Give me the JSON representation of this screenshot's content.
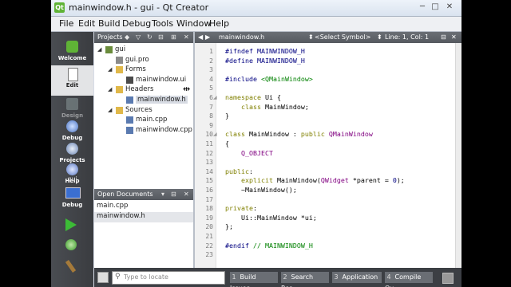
{
  "window": {
    "title": "mainwindow.h - gui - Qt Creator",
    "app_icon": "Qt",
    "controls": {
      "minimize": "─",
      "maximize": "□",
      "close": "✕"
    }
  },
  "menubar": [
    "File",
    "Edit",
    "Build",
    "Debug",
    "Tools",
    "Window",
    "Help"
  ],
  "modes": [
    {
      "label": "Welcome",
      "icon": "qt-logo-icon"
    },
    {
      "label": "Edit",
      "icon": "edit-document-icon",
      "selected": true
    },
    {
      "label": "Design",
      "icon": "design-icon"
    },
    {
      "label": "Debug",
      "icon": "debug-icon"
    },
    {
      "label": "Projects",
      "icon": "projects-icon"
    },
    {
      "label": "Help",
      "icon": "help-icon"
    }
  ],
  "kit": {
    "project": "gui",
    "config": "Debug"
  },
  "projects_pane": {
    "title": "Projects",
    "tree": [
      {
        "label": "gui",
        "level": 0,
        "expanded": true,
        "kind": "project"
      },
      {
        "label": "gui.pro",
        "level": 1,
        "kind": "pro"
      },
      {
        "label": "Forms",
        "level": 1,
        "expanded": true,
        "kind": "folder"
      },
      {
        "label": "mainwindow.ui",
        "level": 2,
        "kind": "ui"
      },
      {
        "label": "Headers",
        "level": 1,
        "expanded": true,
        "kind": "folder"
      },
      {
        "label": "mainwindow.h",
        "level": 2,
        "kind": "h",
        "selected": true
      },
      {
        "label": "Sources",
        "level": 1,
        "expanded": true,
        "kind": "folder"
      },
      {
        "label": "main.cpp",
        "level": 2,
        "kind": "cpp"
      },
      {
        "label": "mainwindow.cpp",
        "level": 2,
        "kind": "cpp"
      }
    ]
  },
  "open_documents": {
    "title": "Open Documents",
    "items": [
      {
        "label": "main.cpp"
      },
      {
        "label": "mainwindow.h",
        "selected": true
      }
    ]
  },
  "editor": {
    "file": "mainwindow.h",
    "symbol": "<Select Symbol>",
    "position": "Line: 1, Col: 1",
    "lines": [
      {
        "n": "1",
        "t": [
          [
            "#ifndef MAINWINDOW_H",
            "pp"
          ]
        ]
      },
      {
        "n": "2",
        "t": [
          [
            "#define MAINWINDOW_H",
            "pp"
          ]
        ]
      },
      {
        "n": "3",
        "t": []
      },
      {
        "n": "4",
        "t": [
          [
            "#include ",
            "pp"
          ],
          [
            "<QMainWindow>",
            "str"
          ]
        ]
      },
      {
        "n": "5",
        "t": []
      },
      {
        "n": "6",
        "t": [
          [
            "namespace ",
            "kw"
          ],
          [
            "Ui {",
            "id"
          ]
        ],
        "fold": true
      },
      {
        "n": "7",
        "t": [
          [
            "    class ",
            "kw"
          ],
          [
            "MainWindow;",
            "id"
          ]
        ]
      },
      {
        "n": "8",
        "t": [
          [
            "}",
            "id"
          ]
        ]
      },
      {
        "n": "9",
        "t": []
      },
      {
        "n": "10",
        "t": [
          [
            "class ",
            "kw"
          ],
          [
            "MainWindow : ",
            "id"
          ],
          [
            "public ",
            "kw"
          ],
          [
            "QMainWindow",
            "ty"
          ]
        ],
        "fold": true
      },
      {
        "n": "11",
        "t": [
          [
            "{",
            "id"
          ]
        ]
      },
      {
        "n": "12",
        "t": [
          [
            "    Q_OBJECT",
            "ty"
          ]
        ]
      },
      {
        "n": "13",
        "t": []
      },
      {
        "n": "14",
        "t": [
          [
            "public",
            "kw"
          ],
          [
            ":",
            "id"
          ]
        ]
      },
      {
        "n": "15",
        "t": [
          [
            "    explicit ",
            "kw"
          ],
          [
            "MainWindow(",
            "id"
          ],
          [
            "QWidget",
            "ty"
          ],
          [
            " *parent = ",
            "id"
          ],
          [
            "0",
            "num"
          ],
          [
            ");",
            "id"
          ]
        ]
      },
      {
        "n": "16",
        "t": [
          [
            "    ~MainWindow();",
            "id"
          ]
        ]
      },
      {
        "n": "17",
        "t": []
      },
      {
        "n": "18",
        "t": [
          [
            "private",
            "kw"
          ],
          [
            ":",
            "id"
          ]
        ]
      },
      {
        "n": "19",
        "t": [
          [
            "    Ui::MainWindow *ui;",
            "id"
          ]
        ]
      },
      {
        "n": "20",
        "t": [
          [
            "};",
            "id"
          ]
        ]
      },
      {
        "n": "21",
        "t": []
      },
      {
        "n": "22",
        "t": [
          [
            "#endif ",
            "pp"
          ],
          [
            "// MAINWINDOW_H",
            "str"
          ]
        ]
      },
      {
        "n": "23",
        "t": []
      }
    ]
  },
  "statusbar": {
    "locate_placeholder": "Type to locate",
    "panes": [
      {
        "num": "1",
        "label": "Build Issues"
      },
      {
        "num": "2",
        "label": "Search Res..."
      },
      {
        "num": "3",
        "label": "Application ..."
      },
      {
        "num": "4",
        "label": "Compile Ou..."
      }
    ]
  },
  "colors": {
    "pp": "#000080",
    "kw": "#808000",
    "ty": "#800080",
    "str": "#008000",
    "qt_green": "#5fb336"
  }
}
